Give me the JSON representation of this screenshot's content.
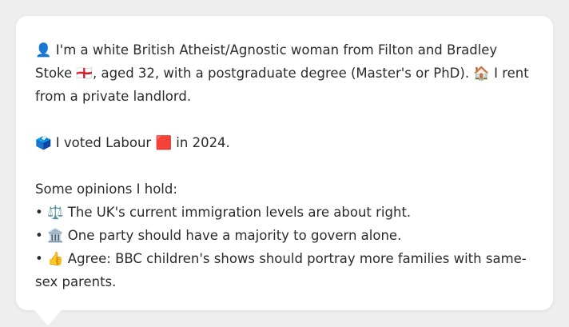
{
  "bio": {
    "icon_person": "👤",
    "text_1": "I'm a white British Atheist/Agnostic woman from Filton and Bradley Stoke",
    "icon_flag": "🏴󠁧󠁢󠁥󠁮󠁧󠁿",
    "text_2": ", aged 32, with a postgraduate degree (Master's or PhD).",
    "icon_house": "🏠",
    "text_3": "I rent from a private landlord."
  },
  "vote": {
    "icon_ballot": "🗳️",
    "text_1": "I voted Labour",
    "icon_red_square": "🟥",
    "text_2": "in 2024."
  },
  "opinions": {
    "heading": "Some opinions I hold:",
    "items": [
      {
        "bullet": "•",
        "icon": "⚖️",
        "text": "The UK's current immigration levels are about right."
      },
      {
        "bullet": "•",
        "icon": "🏛️",
        "text": "One party should have a majority to govern alone."
      },
      {
        "bullet": "•",
        "icon": "👍",
        "text": "Agree: BBC children's shows should portray more families with same-sex parents."
      }
    ]
  }
}
